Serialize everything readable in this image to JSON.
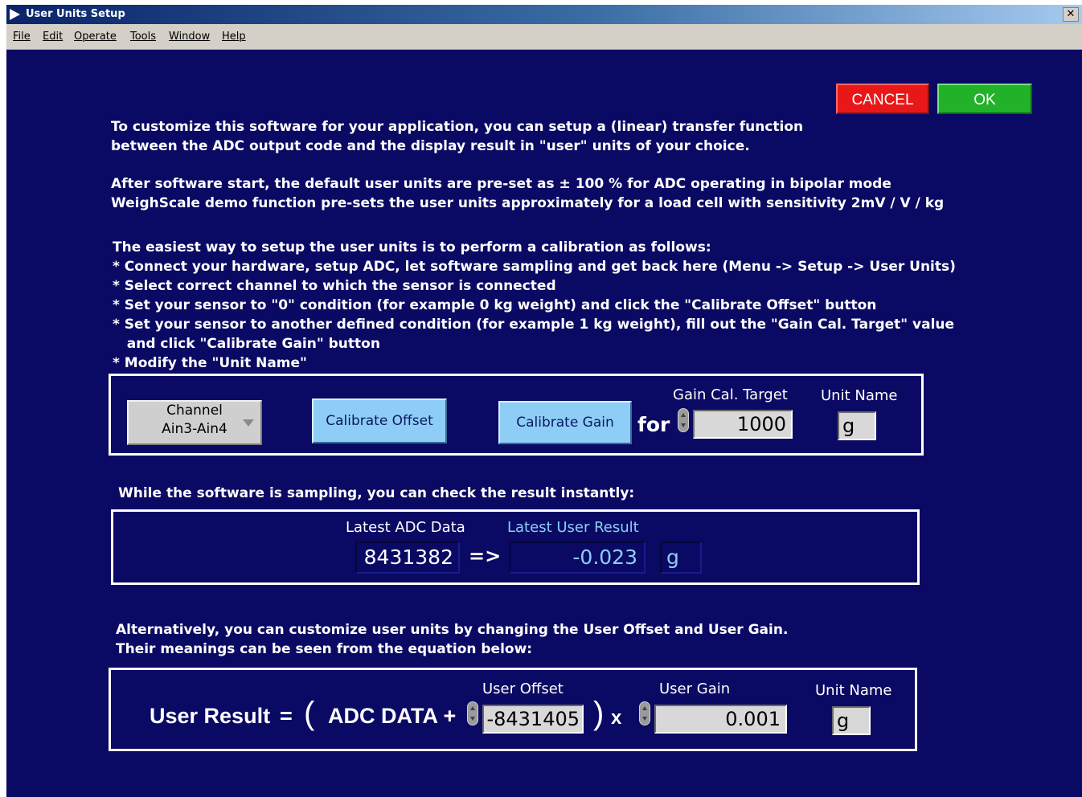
{
  "window": {
    "title": "User Units Setup",
    "close_glyph": "✕"
  },
  "menu": [
    "File",
    "Edit",
    "Operate",
    "Tools",
    "Window",
    "Help"
  ],
  "buttons": {
    "cancel": "CANCEL",
    "ok": "OK"
  },
  "intro": {
    "p1": [
      "To customize this software for your application, you can setup a (linear) transfer function",
      "between the ADC output code and the display result in \"user\" units of your choice."
    ],
    "p2": [
      "After software start, the default user units are pre-set as ± 100 % for ADC operating in bipolar mode",
      "WeighScale demo function pre-sets the user units approximately for a load cell with sensitivity 2mV / V / kg"
    ],
    "p3": [
      "The easiest way to setup the user units is to perform a calibration as follows:",
      "* Connect your hardware, setup ADC, let software sampling and get back here (Menu -> Setup -> User Units)",
      "* Select correct channel to which the sensor is connected",
      "* Set your sensor to \"0\" condition (for example 0 kg weight) and click the \"Calibrate Offset\" button",
      "* Set your sensor to another defined condition (for example 1 kg weight), fill out the \"Gain Cal. Target\" value",
      "   and click \"Calibrate Gain\" button",
      "* Modify the \"Unit Name\""
    ]
  },
  "calibration": {
    "channel_label": "Channel",
    "channel_value": "Ain3-Ain4",
    "calibrate_offset": "Calibrate Offset",
    "calibrate_gain": "Calibrate Gain",
    "for_label": "for",
    "gain_target_label": "Gain Cal. Target",
    "gain_target_value": "1000",
    "unit_name_label": "Unit Name",
    "unit_name_value": "g"
  },
  "sampling_text": "While the software is sampling, you can check the result instantly:",
  "live": {
    "adc_label": "Latest ADC Data",
    "adc_value": "8431382",
    "arrow": "=>",
    "user_label": "Latest User Result",
    "user_value": "-0.023",
    "unit": "g"
  },
  "alt_text": [
    "Alternatively, you can customize user units by changing the User Offset and User Gain.",
    "Their meanings can be seen from the equation below:"
  ],
  "equation": {
    "user_result": "User Result",
    "equals": "=",
    "open_paren": "(",
    "adc_data": "ADC DATA +",
    "close_paren": ")",
    "times": "x",
    "offset_label": "User Offset",
    "offset_value": "-8431405",
    "gain_label": "User Gain",
    "gain_value": "0.001",
    "unit_label": "Unit Name",
    "unit_value": "g"
  },
  "colors": {
    "background": "#0a0a64",
    "cancel": "#e81818",
    "ok": "#22b22a",
    "button_blue": "#8ecdf6"
  }
}
